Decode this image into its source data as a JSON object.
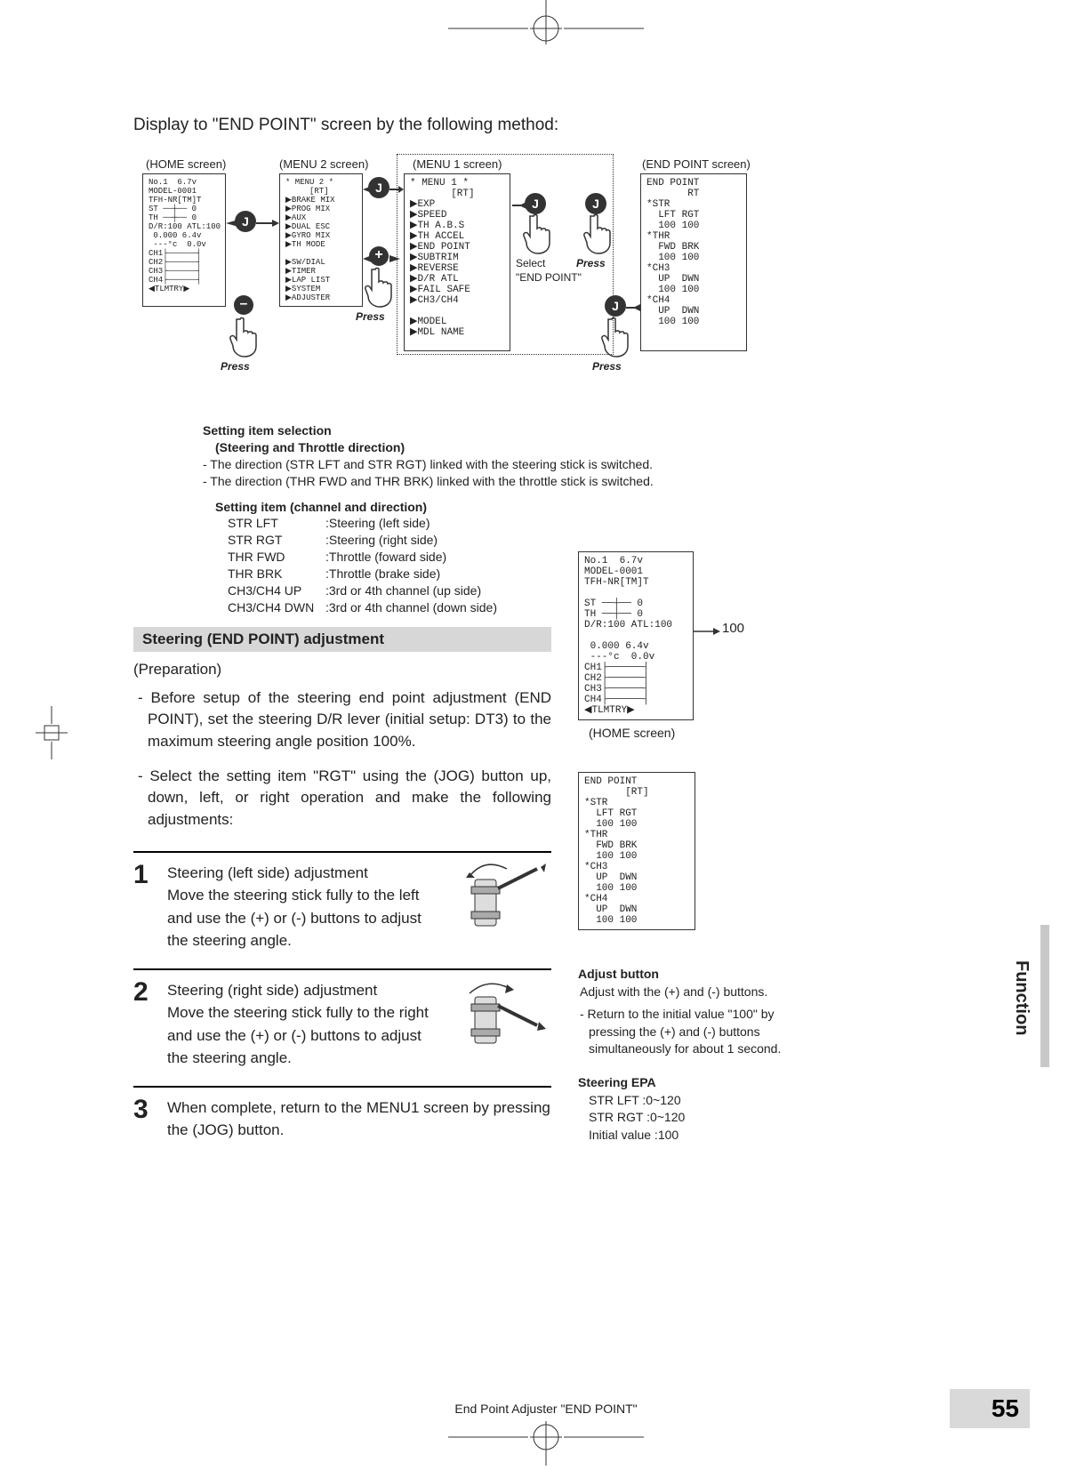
{
  "intro": "Display to \"END POINT\" screen by the following method:",
  "nav": {
    "home_label": "(HOME screen)",
    "menu2_label": "(MENU 2 screen)",
    "menu1_label": "(MENU 1 screen)",
    "endpoint_label": "(END POINT screen)",
    "press": "Press",
    "select": "Select",
    "select_target": "\"END POINT\"",
    "j": "J",
    "plus": "+",
    "minus": "–",
    "menu1_text": "* MENU 1 *\n       [RT]\n▶EXP\n▶SPEED\n▶TH A.B.S\n▶TH ACCEL\n▶END POINT\n▶SUBTRIM\n▶REVERSE\n▶D/R ATL\n▶FAIL SAFE\n▶CH3/CH4\n\n▶MODEL\n▶MDL NAME",
    "menu2_text": "* MENU 2 *\n     [RT]\n▶BRAKE MIX\n▶PROG MIX\n▶AUX\n▶DUAL ESC\n▶GYRO MIX\n▶TH MODE\n\n▶SW/DIAL\n▶TIMER\n▶LAP LIST\n▶SYSTEM\n▶ADJUSTER",
    "home_text": "No.1  6.7v\nMODEL-0001\nTFH-NR[TM]T\nST ──┼── 0\nTH ──┼── 0\nD/R:100 ATL:100\n 0.000 6.4v\n ---°c  0.0v\nCH1├──────┤\nCH2├──────┤\nCH3├──────┤\nCH4├──────┤\n◀TLMTRY▶",
    "ep_text": "END POINT\n       RT\n*STR\n  LFT RGT\n  100 100\n*THR\n  FWD BRK\n  100 100\n*CH3\n  UP  DWN\n  100 100\n*CH4\n  UP  DWN\n  100 100"
  },
  "setting_item": {
    "heading": "Setting item selection",
    "sub": "(Steering and Throttle direction)",
    "line1": "- The direction (STR LFT and STR RGT) linked with the steering stick is switched.",
    "line2": "- The direction (THR FWD and THR BRK) linked with the throttle stick is switched.",
    "table_heading": "Setting item (channel and direction)",
    "rows": [
      {
        "c1": "STR LFT",
        "c2": ":Steering (left side)"
      },
      {
        "c1": "STR RGT",
        "c2": ":Steering (right side)"
      },
      {
        "c1": "THR FWD",
        "c2": ":Throttle (foward side)"
      },
      {
        "c1": "THR BRK",
        "c2": ":Throttle (brake side)"
      },
      {
        "c1": "CH3/CH4 UP",
        "c2": ":3rd or 4th channel (up side)"
      },
      {
        "c1": "CH3/CH4 DWN",
        "c2": ":3rd or 4th channel (down side)"
      }
    ]
  },
  "section_bar": "Steering (END POINT) adjustment",
  "preparation": "(Preparation)",
  "para1": "- Before setup of the steering end point adjustment (END POINT), set the steering D/R lever (initial setup: DT3) to the maximum steering angle position 100%.",
  "para2": "- Select the setting item \"RGT\" using the (JOG) button up, down, left, or right operation and make the following adjustments:",
  "steps": [
    {
      "n": "1",
      "title": "Steering (left side) adjustment",
      "body": "Move the steering stick fully to the left and use the (+) or (-) buttons to adjust the steering angle."
    },
    {
      "n": "2",
      "title": "Steering (right side) adjustment",
      "body": "Move the steering stick fully to the right and use the (+) or (-) buttons to adjust the steering angle."
    },
    {
      "n": "3",
      "title": "",
      "body": "When complete, return to the MENU1 screen by pressing the (JOG) button."
    }
  ],
  "right": {
    "home_text": "No.1  6.7v\nMODEL-0001\nTFH-NR[TM]T\n\nST ──┼── 0\nTH ──┼── 0\nD/R:100 ATL:100\n\n 0.000 6.4v\n ---°c  0.0v\nCH1├──────┤\nCH2├──────┤\nCH3├──────┤\nCH4├──────┤\n◀TLMTRY▶",
    "arrow_val": "100",
    "home_caption": "(HOME screen)",
    "ep_text": "END POINT\n       [RT]\n*STR\n  LFT RGT\n  100 100\n*THR\n  FWD BRK\n  100 100\n*CH3\n  UP  DWN\n  100 100\n*CH4\n  UP  DWN\n  100 100",
    "adjust_h": "Adjust button",
    "adjust_p1": "Adjust with the (+) and (-) buttons.",
    "adjust_p2": "- Return to the initial value \"100\" by pressing the (+) and (-) buttons simultaneously for about 1 second.",
    "epa_h": "Steering EPA",
    "epa_l1": "STR LFT  :0~120",
    "epa_l2": "STR RGT :0~120",
    "epa_l3": "Initial value :100"
  },
  "side_tab": "Function",
  "footer": "End Point Adjuster  \"END POINT\"",
  "page_num": "55"
}
